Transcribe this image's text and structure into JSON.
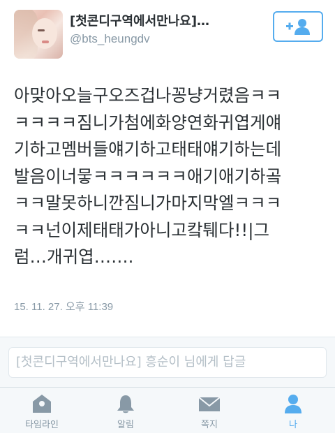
{
  "profile": {
    "display_name": "[첫콘디구역에서만나요]…",
    "screen_name": "@bts_heungdv"
  },
  "follow_button": {
    "icon": "add-user-icon",
    "color": "#55acee"
  },
  "tweet": {
    "lines": [
      "아맞아오늘구오즈겁나꽁냥거렸음ㅋㅋ",
      "ㅋㅋㅋㅋ짐니가첨에화양연화귀엽게얘",
      "기하고멤버들얘기하고태태얘기하는데",
      "발음이너뭏ㅋㅋㅋㅋㅋㅋ애기애기하곸",
      "ㅋㅋ말못하니깐짐니가마지막엘ㅋㅋㅋ",
      "ㅋㅋ넌이제태태가아니고캌퉤다!!|그",
      "럼…개귀엽……."
    ],
    "timestamp": "15. 11. 27. 오후 11:39"
  },
  "reply": {
    "placeholder": "[첫콘디구역에서만나요] 흥순이 님에게 답글"
  },
  "tabs": [
    {
      "label": "타임라인",
      "icon": "home-icon"
    },
    {
      "label": "알림",
      "icon": "bell-icon"
    },
    {
      "label": "쪽지",
      "icon": "envelope-icon"
    },
    {
      "label": "나",
      "icon": "person-icon",
      "active": true
    }
  ],
  "colors": {
    "accent": "#55acee",
    "inactive": "#8899a6",
    "text": "#292f33"
  }
}
